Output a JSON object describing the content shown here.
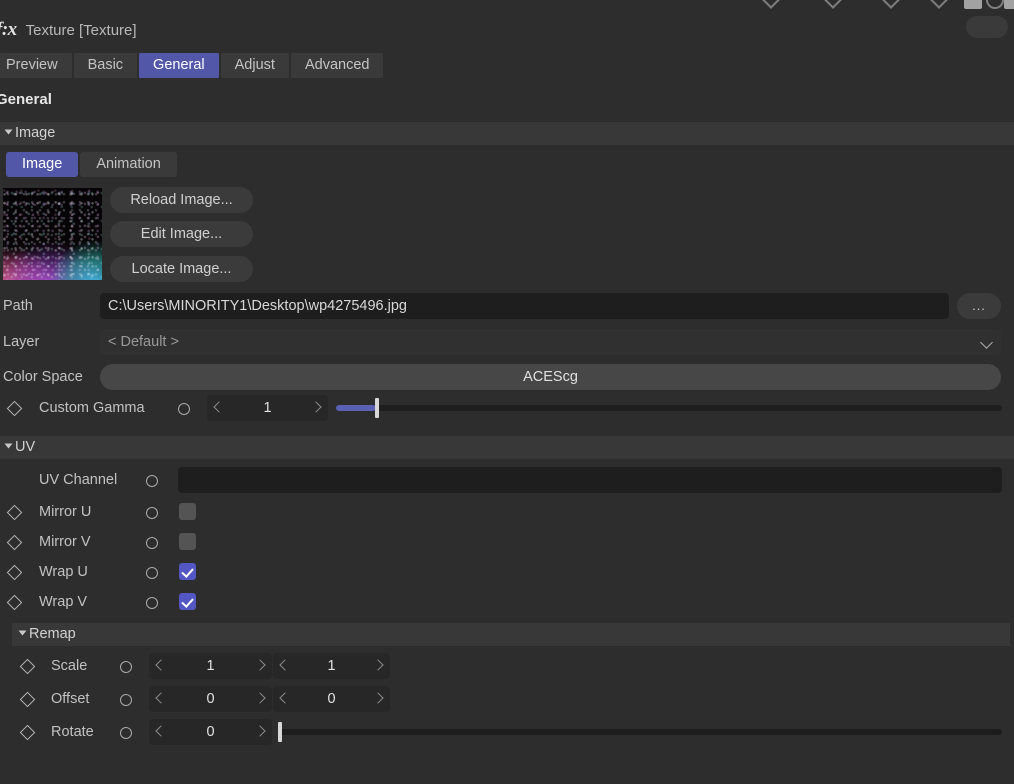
{
  "window": {
    "icon": "fx-icon",
    "icon_glyph": "f:x",
    "title": "Texture [Texture]"
  },
  "tabs": [
    {
      "label": "Preview",
      "active": false
    },
    {
      "label": "Basic",
      "active": false
    },
    {
      "label": "General",
      "active": true
    },
    {
      "label": "Adjust",
      "active": false
    },
    {
      "label": "Advanced",
      "active": false
    }
  ],
  "page_title": "General",
  "sections": {
    "image": {
      "header": "Image",
      "mode_tabs": [
        {
          "label": "Image",
          "active": true
        },
        {
          "label": "Animation",
          "active": false
        }
      ],
      "buttons": [
        {
          "label": "Reload Image..."
        },
        {
          "label": "Edit Image..."
        },
        {
          "label": "Locate Image..."
        }
      ],
      "rows": {
        "path": {
          "label": "Path",
          "value": "C:\\Users\\MINORITY1\\Desktop\\wp4275496.jpg",
          "browse_label": "..."
        },
        "layer": {
          "label": "Layer",
          "value": "< Default >"
        },
        "color_space": {
          "label": "Color Space",
          "value": "ACEScg"
        },
        "custom_gamma": {
          "label": "Custom Gamma",
          "value": "1",
          "slider_percent": 6
        }
      }
    },
    "uv": {
      "header": "UV",
      "rows": {
        "uv_channel": {
          "label": "UV Channel",
          "value": ""
        },
        "mirror_u": {
          "label": "Mirror U",
          "checked": false
        },
        "mirror_v": {
          "label": "Mirror V",
          "checked": false
        },
        "wrap_u": {
          "label": "Wrap U",
          "checked": true
        },
        "wrap_v": {
          "label": "Wrap V",
          "checked": true
        }
      }
    },
    "remap": {
      "header": "Remap",
      "rows": {
        "scale": {
          "label": "Scale",
          "x": "1",
          "y": "1"
        },
        "offset": {
          "label": "Offset",
          "x": "0",
          "y": "0"
        },
        "rotate": {
          "label": "Rotate",
          "x": "0",
          "slider_percent": 0
        }
      }
    }
  },
  "colors": {
    "accent": "#5257a8",
    "checkbox_on": "#5257c4",
    "slider_fill": "#5a60b4",
    "panel_bg": "#2d2d2d",
    "band_bg": "#383838",
    "field_bg": "#1e1e1e"
  }
}
